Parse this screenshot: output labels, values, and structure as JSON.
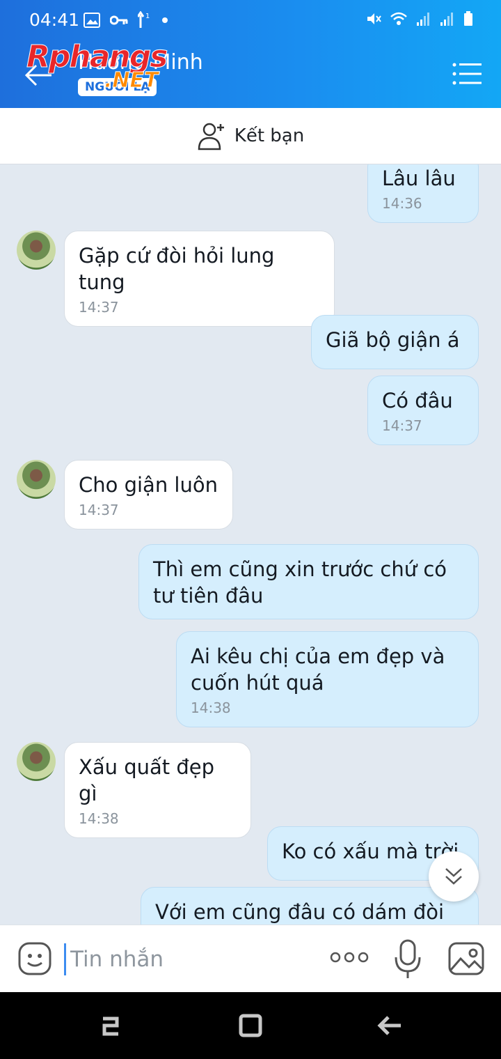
{
  "status_bar": {
    "time": "04:41",
    "left_icons": [
      "image-icon",
      "key-icon",
      "data-arrow-icon"
    ],
    "right_icons": [
      "mute-icon",
      "wifi-icon",
      "signal-icon",
      "signal-icon",
      "battery-icon"
    ],
    "indicator": "1"
  },
  "header": {
    "contact_name": "Hương Minh",
    "contact_tag": "NGƯỜI LẠ",
    "watermark": "Rphangs",
    "watermark_suffix": ".NET"
  },
  "friend_bar": {
    "label": "Kết bạn"
  },
  "messages": [
    {
      "dir": "out",
      "text": "Lâu lâu",
      "time": "14:36"
    },
    {
      "dir": "in",
      "text": "Gặp cứ đòi hỏi lung tung",
      "time": "14:37"
    },
    {
      "dir": "out",
      "text": "Giã bộ giận á",
      "time": ""
    },
    {
      "dir": "out",
      "text": "Có đâu",
      "time": "14:37"
    },
    {
      "dir": "in",
      "text": "Cho giận luôn",
      "time": "14:37"
    },
    {
      "dir": "out",
      "text": "Thì em cũng xin trước chứ có tư tiên đâu",
      "time": ""
    },
    {
      "dir": "out",
      "text": "Ai kêu chị của em đẹp và cuốn hút quá",
      "time": "14:38"
    },
    {
      "dir": "in",
      "text": "Xấu quất đẹp gì",
      "time": "14:38"
    },
    {
      "dir": "out",
      "text": "Ko có xấu mà trời",
      "time": ""
    },
    {
      "dir": "out",
      "text": "Với em cũng đâu có dám đòi",
      "time": ""
    }
  ],
  "input_bar": {
    "placeholder": "Tin nhắn"
  },
  "colors": {
    "header_start": "#1e6fdc",
    "header_end": "#13a7f5",
    "outgoing_bubble": "#d5eefd",
    "incoming_bubble": "#ffffff",
    "chat_bg": "#e2e9f1"
  }
}
